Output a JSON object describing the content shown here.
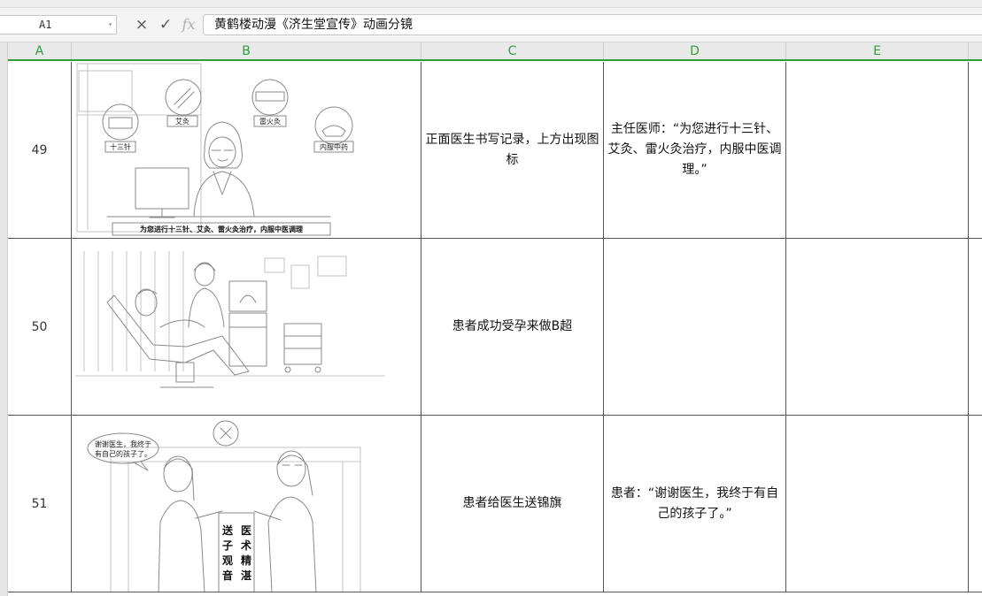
{
  "formula_bar": {
    "cell_ref": "A1",
    "cancel_icon": "×",
    "confirm_icon": "✓",
    "fx_label": "fx",
    "content": "黄鹤楼动漫《济生堂宣传》动画分镜"
  },
  "columns": [
    "A",
    "B",
    "C",
    "D",
    "E"
  ],
  "rows": [
    {
      "num": "49",
      "c": "正面医生书写记录，上方出现图标",
      "d": "主任医师：“为您进行十三针、艾灸、雷火灸治疗，内服中医调理。”",
      "icons": [
        "十三针",
        "艾灸",
        "雷火灸",
        "内服中药"
      ],
      "caption": "为您进行十三针、艾灸、雷火灸治疗，内服中医调理"
    },
    {
      "num": "50",
      "c": "患者成功受孕来做B超",
      "d": ""
    },
    {
      "num": "51",
      "c": "患者给医生送锦旗",
      "d": "患者：“谢谢医生，我终于有自己的孩子了。”",
      "bubble_line1": "谢谢医生，我终于",
      "bubble_line2": "有自己的孩子了。",
      "banner_right": [
        "医",
        "术",
        "精",
        "湛"
      ],
      "banner_left": [
        "送",
        "子",
        "观",
        "音"
      ]
    }
  ]
}
